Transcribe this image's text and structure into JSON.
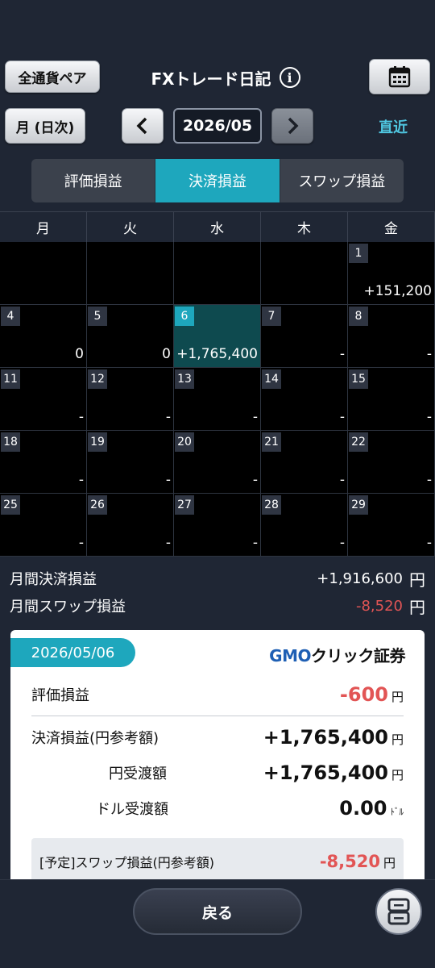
{
  "header": {
    "currency_pair_button": "全通貨ペア",
    "title": "FXトレード日記",
    "info_icon": "i",
    "calendar_icon": "calendar-icon"
  },
  "nav": {
    "period_button": "月 (日次)",
    "prev": "‹",
    "next": "›",
    "current_month": "2026/05",
    "recent_link": "直近"
  },
  "tabs": [
    {
      "label": "評価損益",
      "active": false
    },
    {
      "label": "決済損益",
      "active": true
    },
    {
      "label": "スワップ損益",
      "active": false
    }
  ],
  "weekdays": [
    "月",
    "火",
    "水",
    "木",
    "金"
  ],
  "calendar": [
    {
      "day": "",
      "value": ""
    },
    {
      "day": "",
      "value": ""
    },
    {
      "day": "",
      "value": ""
    },
    {
      "day": "",
      "value": ""
    },
    {
      "day": "1",
      "value": "+151,200"
    },
    {
      "day": "4",
      "value": "0"
    },
    {
      "day": "5",
      "value": "0"
    },
    {
      "day": "6",
      "value": "+1,765,400",
      "selected": true
    },
    {
      "day": "7",
      "value": "-"
    },
    {
      "day": "8",
      "value": "-"
    },
    {
      "day": "11",
      "value": "-"
    },
    {
      "day": "12",
      "value": "-"
    },
    {
      "day": "13",
      "value": "-"
    },
    {
      "day": "14",
      "value": "-"
    },
    {
      "day": "15",
      "value": "-"
    },
    {
      "day": "18",
      "value": "-"
    },
    {
      "day": "19",
      "value": "-"
    },
    {
      "day": "20",
      "value": "-"
    },
    {
      "day": "21",
      "value": "-"
    },
    {
      "day": "22",
      "value": "-"
    },
    {
      "day": "25",
      "value": "-"
    },
    {
      "day": "26",
      "value": "-"
    },
    {
      "day": "27",
      "value": "-"
    },
    {
      "day": "28",
      "value": "-"
    },
    {
      "day": "29",
      "value": "-"
    }
  ],
  "summary": {
    "settlement_label": "月間決済損益",
    "settlement_value": "+1,916,600",
    "swap_label": "月間スワップ損益",
    "swap_value": "-8,520",
    "yen": "円"
  },
  "detail": {
    "date": "2026/05/06",
    "brand_gmo": "GMO",
    "brand_rest": "クリック証券",
    "unrealized_label": "評価損益",
    "unrealized_value": "-600",
    "settlement_label": "決済損益(円参考額)",
    "settlement_value": "+1,765,400",
    "yen_transfer_label": "円受渡額",
    "yen_transfer_value": "+1,765,400",
    "dollar_transfer_label": "ドル受渡額",
    "dollar_transfer_value": "0.00",
    "dollar_unit": "ﾄﾞﾙ",
    "swap_label": "[予定]スワップ損益(円参考額)",
    "swap_value": "-8,520",
    "yen": "円"
  },
  "footer": {
    "back_button": "戻る"
  },
  "colors": {
    "accent": "#1ea7bd",
    "negative": "#e25555",
    "background": "#1f2634"
  }
}
